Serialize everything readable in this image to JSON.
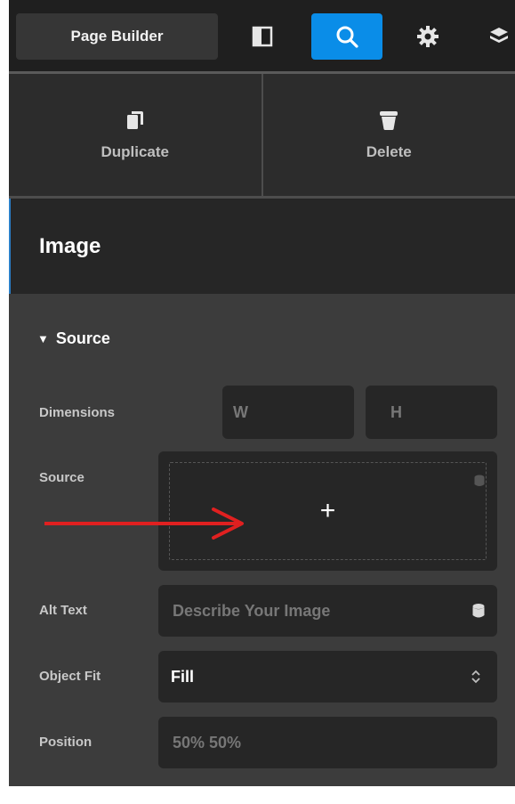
{
  "topbar": {
    "brand_label": "Page Builder",
    "icons": [
      "layout-icon",
      "search-icon",
      "gear-icon",
      "stack-icon"
    ],
    "active_color": "#0a8de8"
  },
  "actions": {
    "duplicate_label": "Duplicate",
    "delete_label": "Delete"
  },
  "element": {
    "title": "Image"
  },
  "section": {
    "title": "Source",
    "dimensions": {
      "label": "Dimensions",
      "w_placeholder": "W",
      "h_placeholder": "H"
    },
    "source": {
      "label": "Source",
      "add_symbol": "+"
    },
    "alt_text": {
      "label": "Alt Text",
      "placeholder": "Describe Your Image"
    },
    "object_fit": {
      "label": "Object Fit",
      "value": "Fill"
    },
    "position": {
      "label": "Position",
      "value": "50% 50%"
    }
  },
  "annotation": {
    "arrow_color": "#e02020"
  }
}
